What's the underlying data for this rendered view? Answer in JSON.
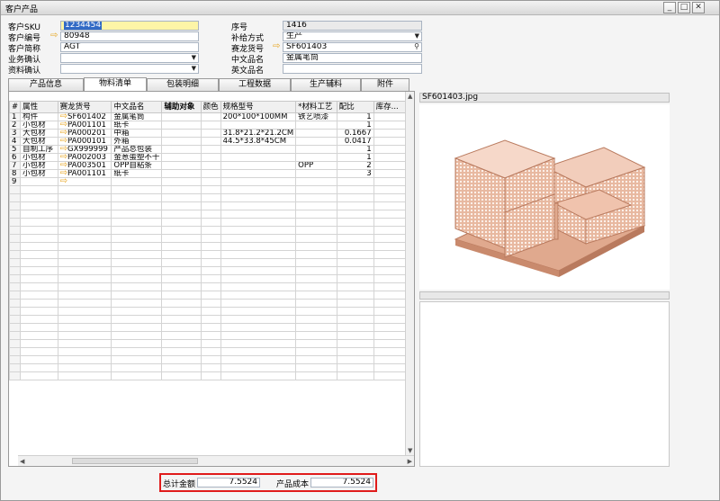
{
  "window": {
    "title": "客户产品",
    "btn_min": "_",
    "btn_max": "□",
    "btn_close": "✕"
  },
  "header": {
    "customer_sku_label": "客户SKU",
    "customer_sku_value": "1234454",
    "customer_code_label": "客户编号",
    "customer_code_value": "80948",
    "customer_short_label": "客户简称",
    "customer_short_value": "AGT",
    "business_confirm_label": "业务确认",
    "business_confirm_value": "",
    "data_confirm_label": "资料确认",
    "data_confirm_value": "",
    "serial_label": "序号",
    "serial_value": "1416",
    "replenish_label": "补给方式",
    "replenish_value": "生产",
    "sailong_label": "赛龙货号",
    "sailong_value": "SF601403",
    "cn_name_label": "中文品名",
    "cn_name_value": "金属笔筒",
    "en_name_label": "英文品名",
    "en_name_value": ""
  },
  "tabs": [
    "产品信息",
    "物料清单",
    "包装明细",
    "工程数据",
    "生产辅料",
    "附件"
  ],
  "grid": {
    "columns": [
      "#",
      "属性",
      "赛龙货号",
      "中文品名",
      "辅助对象",
      "颜色",
      "规格型号",
      "*材料工艺",
      "配比",
      "库存..."
    ],
    "rows": [
      [
        "1",
        "构件",
        "SF601402",
        "金属笔筒",
        "",
        "",
        "200*100*100MM",
        "铁艺喷漆",
        "1",
        ""
      ],
      [
        "2",
        "小包材",
        "PA001101",
        "纸卡",
        "",
        "",
        "",
        "",
        "1",
        ""
      ],
      [
        "3",
        "大包材",
        "PA000201",
        "中箱",
        "",
        "",
        "31.8*21.2*21.2CM",
        "",
        "0.1667",
        ""
      ],
      [
        "4",
        "大包材",
        "PA000101",
        "外箱",
        "",
        "",
        "44.5*33.8*45CM",
        "",
        "0.0417",
        ""
      ],
      [
        "5",
        "自制工序",
        "GX999999",
        "产品总包装",
        "",
        "",
        "",
        "",
        "1",
        ""
      ],
      [
        "6",
        "小包材",
        "PA002003",
        "金葱蛋塑不干",
        "",
        "",
        "",
        "",
        "1",
        ""
      ],
      [
        "7",
        "小包材",
        "PA003501",
        "OPP自粘条",
        "",
        "",
        "",
        "OPP",
        "2",
        ""
      ],
      [
        "8",
        "小包材",
        "PA001101",
        "纸卡",
        "",
        "",
        "",
        "",
        "3",
        ""
      ],
      [
        "9",
        "",
        "",
        "",
        "",
        "",
        "",
        "",
        "",
        ""
      ]
    ]
  },
  "image": {
    "caption": "SF601403.jpg",
    "subject": "rose-gold-mesh-desk-organizer"
  },
  "footer": {
    "total_label": "总计金额",
    "total_value": "7.5524",
    "cost_label": "产品成本",
    "cost_value": "7.5524"
  },
  "colors": {
    "selection": "#316ac5",
    "highlight_field": "#fdf5a7",
    "arrow": "#e7a51f",
    "red_box": "#e01b1b"
  }
}
